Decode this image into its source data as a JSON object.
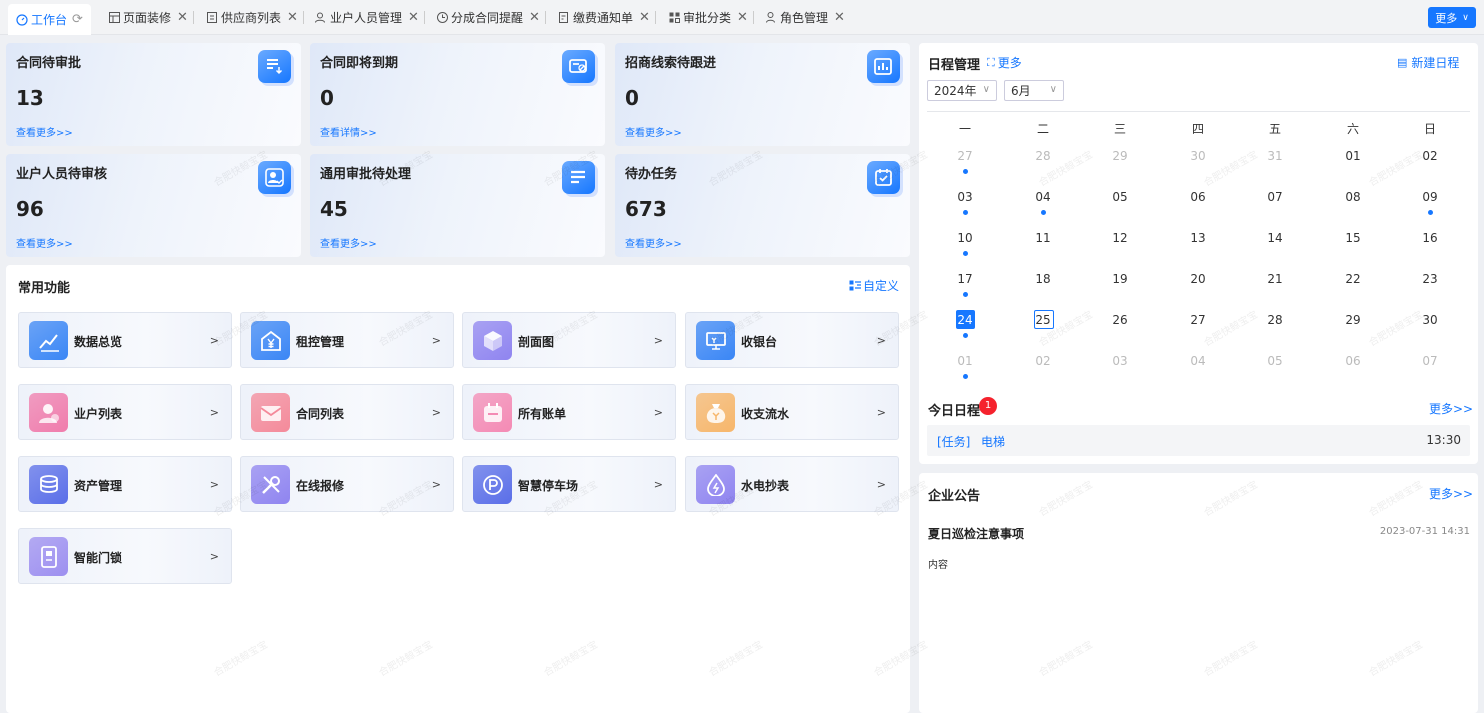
{
  "tabs": [
    {
      "label": "工作台",
      "icon": "dashboard-icon",
      "active": true
    },
    {
      "label": "页面装修",
      "icon": "layout-icon"
    },
    {
      "label": "供应商列表",
      "icon": "document-icon"
    },
    {
      "label": "业户人员管理",
      "icon": "users-icon"
    },
    {
      "label": "分成合同提醒",
      "icon": "clock-icon"
    },
    {
      "label": "缴费通知单",
      "icon": "bill-icon"
    },
    {
      "label": "审批分类",
      "icon": "grid-icon"
    },
    {
      "label": "角色管理",
      "icon": "user-icon"
    }
  ],
  "tabbar": {
    "more_label": "更多"
  },
  "stats": [
    {
      "title": "合同待审批",
      "value": "13",
      "link": "查看更多>>",
      "icon": "list-download-icon"
    },
    {
      "title": "合同即将到期",
      "value": "0",
      "link": "查看详情>>",
      "icon": "card-slash-icon"
    },
    {
      "title": "招商线索待跟进",
      "value": "0",
      "link": "查看更多>>",
      "icon": "chart-bar-icon"
    },
    {
      "title": "业户人员待审核",
      "value": "96",
      "link": "查看更多>>",
      "icon": "user-check-icon"
    },
    {
      "title": "通用审批待处理",
      "value": "45",
      "link": "查看更多>>",
      "icon": "list-icon"
    },
    {
      "title": "待办任务",
      "value": "673",
      "link": "查看更多>>",
      "icon": "calendar-check-icon"
    }
  ],
  "functions": {
    "title": "常用功能",
    "customize_label": "自定义",
    "items": [
      {
        "label": "数据总览",
        "arrow": ">",
        "color": "#3a86f5",
        "icon": "line-chart-icon"
      },
      {
        "label": "租控管理",
        "arrow": ">",
        "color": "#3a86f5",
        "icon": "house-yen-icon"
      },
      {
        "label": "剖面图",
        "arrow": ">",
        "color": "#8f84f0",
        "icon": "cube-icon"
      },
      {
        "label": "收银台",
        "arrow": ">",
        "color": "#3a86f5",
        "icon": "cashier-icon"
      },
      {
        "label": "业户列表",
        "arrow": ">",
        "color": "#f07cac",
        "icon": "user-badge-icon"
      },
      {
        "label": "合同列表",
        "arrow": ">",
        "color": "#f48a9a",
        "icon": "envelope-icon"
      },
      {
        "label": "所有账单",
        "arrow": ">",
        "color": "#f48ab4",
        "icon": "bill-calendar-icon"
      },
      {
        "label": "收支流水",
        "arrow": ">",
        "color": "#f7b66a",
        "icon": "money-bag-icon"
      },
      {
        "label": "资产管理",
        "arrow": ">",
        "color": "#5a6ee8",
        "icon": "coin-stack-icon"
      },
      {
        "label": "在线报修",
        "arrow": ">",
        "color": "#8f84f0",
        "icon": "tools-icon"
      },
      {
        "label": "智慧停车场",
        "arrow": ">",
        "color": "#5a6ee8",
        "icon": "parking-icon"
      },
      {
        "label": "水电抄表",
        "arrow": ">",
        "color": "#8f84f0",
        "icon": "water-drop-icon"
      },
      {
        "label": "智能门锁",
        "arrow": ">",
        "color": "#9d8ff0",
        "icon": "door-lock-icon"
      }
    ]
  },
  "schedule": {
    "title": "日程管理",
    "more_label": "更多",
    "new_label": "新建日程",
    "year": "2024年",
    "month": "6月",
    "weekdays": [
      "一",
      "二",
      "三",
      "四",
      "五",
      "六",
      "日"
    ],
    "days": [
      "27",
      "28",
      "29",
      "30",
      "31",
      "01",
      "02",
      "03",
      "04",
      "05",
      "06",
      "07",
      "08",
      "09",
      "10",
      "11",
      "12",
      "13",
      "14",
      "15",
      "16",
      "17",
      "18",
      "19",
      "20",
      "21",
      "22",
      "23",
      "24",
      "25",
      "26",
      "27",
      "28",
      "29",
      "30",
      "01",
      "02",
      "03",
      "04",
      "05",
      "06",
      "07"
    ]
  },
  "today": {
    "title": "今日日程",
    "badge": "1",
    "more_label": "更多>>",
    "item_tag": "[任务]",
    "item_text": "电梯",
    "item_time": "13:30"
  },
  "notice": {
    "title": "企业公告",
    "more_label": "更多>>",
    "item_title": "夏日巡检注意事项",
    "item_time": "2023-07-31 14:31",
    "item_content": "内容"
  },
  "watermark": "合肥快鲸宝宝",
  "colors": {
    "accent": "#1677ff",
    "badge": "#f5222d"
  }
}
